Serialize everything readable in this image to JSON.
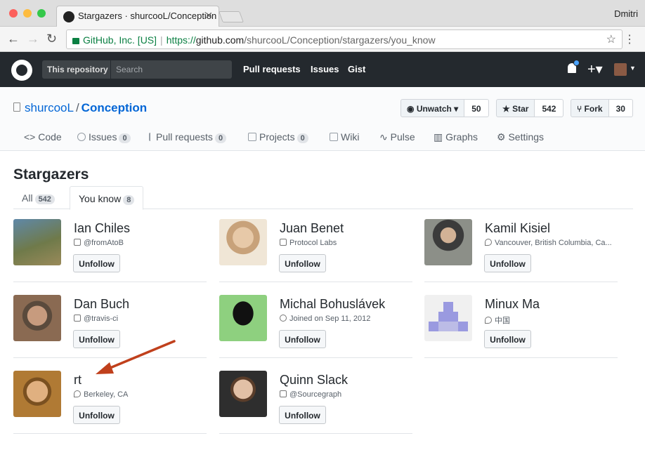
{
  "browser": {
    "tab_title": "Stargazers · shurcooL/Conception",
    "user": "Dmitri",
    "security_label": "GitHub, Inc. [US]",
    "url_proto": "https://",
    "url_host": "github.com",
    "url_path": "/shurcooL/Conception/stargazers/you_know"
  },
  "gh_header": {
    "scope": "This repository",
    "search_placeholder": "Search",
    "links": [
      "Pull requests",
      "Issues",
      "Gist"
    ]
  },
  "repo": {
    "owner": "shurcooL",
    "name": "Conception",
    "watch_label": "Unwatch",
    "watch_count": "50",
    "star_label": "Star",
    "star_count": "542",
    "fork_label": "Fork",
    "fork_count": "30"
  },
  "repo_tabs": [
    {
      "label": "Code",
      "count": ""
    },
    {
      "label": "Issues",
      "count": "0"
    },
    {
      "label": "Pull requests",
      "count": "0"
    },
    {
      "label": "Projects",
      "count": "0"
    },
    {
      "label": "Wiki",
      "count": ""
    },
    {
      "label": "Pulse",
      "count": ""
    },
    {
      "label": "Graphs",
      "count": ""
    },
    {
      "label": "Settings",
      "count": ""
    }
  ],
  "page": {
    "title": "Stargazers",
    "tab_all": "All",
    "tab_all_count": "542",
    "tab_you_know": "You know",
    "tab_you_know_count": "8"
  },
  "unfollow_label": "Unfollow",
  "users": [
    {
      "name": "Ian Chiles",
      "meta": "@fromAtoB",
      "meta_icon": "organization-icon",
      "avatar_color": "#6f7a4a"
    },
    {
      "name": "Juan Benet",
      "meta": "Protocol Labs",
      "meta_icon": "organization-icon",
      "avatar_color": "#c8a27a"
    },
    {
      "name": "Kamil Kisiel",
      "meta": "Vancouver, British Columbia, Ca...",
      "meta_icon": "location-icon",
      "avatar_color": "#7d7f7a"
    },
    {
      "name": "Dan Buch",
      "meta": "@travis-ci",
      "meta_icon": "organization-icon",
      "avatar_color": "#8a6a52"
    },
    {
      "name": "Michal Bohuslávek",
      "meta": "Joined on Sep 11, 2012",
      "meta_icon": "clock-icon",
      "avatar_color": "#8ed07f"
    },
    {
      "name": "Minux Ma",
      "meta": "中国",
      "meta_icon": "location-icon",
      "avatar_color": "#eeeeee"
    },
    {
      "name": "rt",
      "meta": "Berkeley, CA",
      "meta_icon": "location-icon",
      "avatar_color": "#b07a34"
    },
    {
      "name": "Quinn Slack",
      "meta": "@Sourcegraph",
      "meta_icon": "organization-icon",
      "avatar_color": "#3c3c3c"
    }
  ],
  "colors": {
    "header_bg": "#24292e",
    "link_blue": "#0366d6",
    "annotation_arrow": "#c0401c"
  }
}
